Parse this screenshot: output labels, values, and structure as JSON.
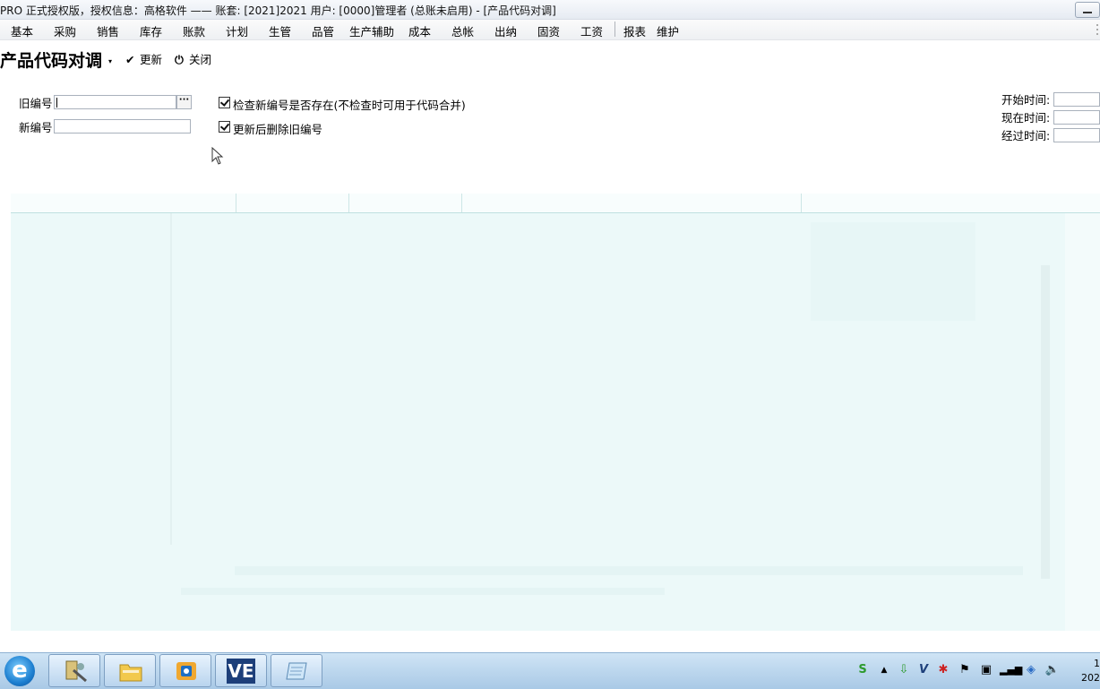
{
  "window": {
    "title": "PRO 正式授权版，授权信息：高格软件  —— 账套: [2021]2021  用户: [0000]管理者   (总账未启用)    - [产品代码对调]"
  },
  "menu": {
    "items": [
      "基本",
      "采购",
      "销售",
      "库存",
      "账款",
      "计划",
      "生管",
      "品管",
      "生产辅助",
      "成本",
      "总帐",
      "出纳",
      "固资",
      "工资",
      "报表",
      "维护"
    ]
  },
  "toolbar": {
    "form_title": "产品代码对调",
    "update_label": "更新",
    "close_label": "关闭"
  },
  "form": {
    "old_code_label": "旧编号",
    "old_code_value": "",
    "lookup_label": "···",
    "new_code_label": "新编号",
    "new_code_value": "",
    "check_exists_label": "检查新编号是否存在(不检查时可用于代码合并)",
    "check_exists_checked": true,
    "delete_old_label": "更新后删除旧编号",
    "delete_old_checked": true
  },
  "timer": {
    "start_label": "开始时间:",
    "start_value": "",
    "now_label": "现在时间:",
    "now_value": "",
    "elapsed_label": "经过时间:",
    "elapsed_value": ""
  },
  "taskbar": {
    "apps": [
      "tools-icon",
      "folder-icon",
      "outlook-icon",
      "ve-icon",
      "notepad-icon"
    ],
    "ve_label": "VE",
    "clock_time": "1",
    "clock_date": "202"
  },
  "colors": {
    "grid_bg": "#ecf9f9",
    "taskbar": "#b9d4ee"
  }
}
